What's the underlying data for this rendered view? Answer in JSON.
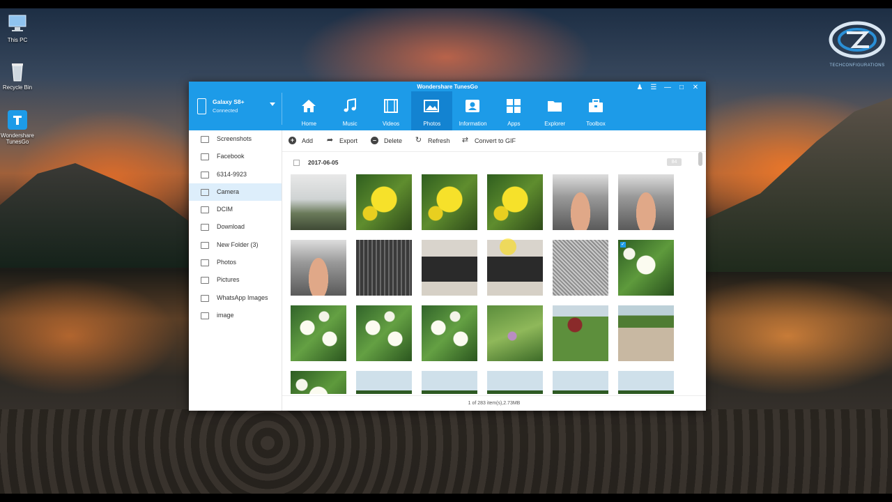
{
  "desktop": {
    "icons": [
      {
        "label": "This PC"
      },
      {
        "label": "Recycle Bin"
      },
      {
        "label": "Wondershare TunesGo"
      }
    ],
    "watermark": "TECHCONFIGURATIONS"
  },
  "app": {
    "title": "Wondershare TunesGo",
    "device": {
      "name": "Galaxy S8+",
      "status": "Connected"
    },
    "nav": [
      {
        "label": "Home",
        "icon": "home-icon"
      },
      {
        "label": "Music",
        "icon": "music-icon"
      },
      {
        "label": "Videos",
        "icon": "video-icon"
      },
      {
        "label": "Photos",
        "icon": "photo-icon",
        "active": true
      },
      {
        "label": "Information",
        "icon": "contact-icon"
      },
      {
        "label": "Apps",
        "icon": "apps-icon"
      },
      {
        "label": "Explorer",
        "icon": "folder-icon"
      },
      {
        "label": "Toolbox",
        "icon": "toolbox-icon"
      }
    ],
    "sidebar": [
      {
        "label": "Screenshots"
      },
      {
        "label": "Facebook"
      },
      {
        "label": "6314-9923"
      },
      {
        "label": "Camera",
        "active": true
      },
      {
        "label": "DCIM"
      },
      {
        "label": "Download"
      },
      {
        "label": "New Folder (3)"
      },
      {
        "label": "Photos"
      },
      {
        "label": "Pictures"
      },
      {
        "label": "WhatsApp Images"
      },
      {
        "label": "image"
      }
    ],
    "toolbar": {
      "add": "Add",
      "export": "Export",
      "delete": "Delete",
      "refresh": "Refresh",
      "gif": "Convert to GIF"
    },
    "group": {
      "date": "2017-06-05",
      "count": "84"
    },
    "status": "1 of 283 item(s),2.73MB",
    "accent": "#1d9be8"
  }
}
